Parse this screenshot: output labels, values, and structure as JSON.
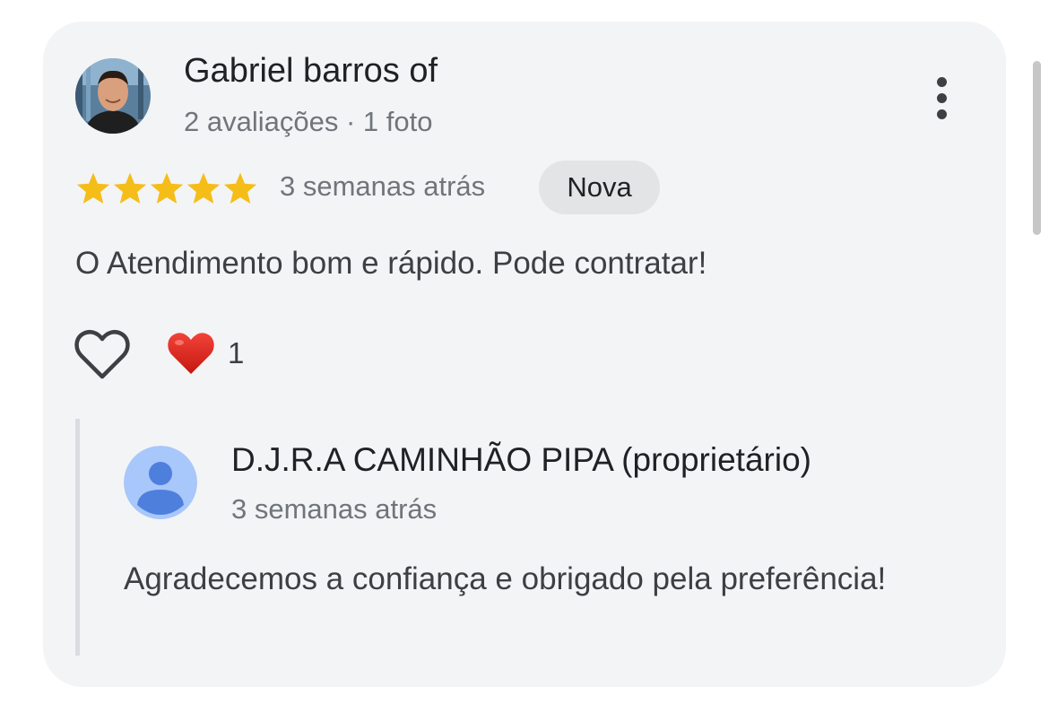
{
  "review": {
    "author_name": "Gabriel barros of",
    "author_meta": "2 avaliações · 1 foto",
    "rating": 5,
    "rating_max": 5,
    "time": "3 semanas atrás",
    "badge": "Nova",
    "text": "O Atendimento bom e rápido. Pode contratar!",
    "reactions": {
      "like_icon": "heart-outline-icon",
      "reaction_icon": "red-heart-icon",
      "count": "1"
    }
  },
  "reply": {
    "owner_name": "D.J.R.A CAMINHÃO PIPA (proprietário)",
    "time": "3 semanas atrás",
    "text": "Agradecemos a confiança e obrigado pela preferência!"
  },
  "colors": {
    "card_background": "#f3f4f6",
    "star": "#f5bd18",
    "badge_background": "#e3e4e6",
    "heart": "#e0241c",
    "owner_avatar_bg": "#a8c7fa",
    "owner_avatar_fg": "#4f7fdd"
  }
}
